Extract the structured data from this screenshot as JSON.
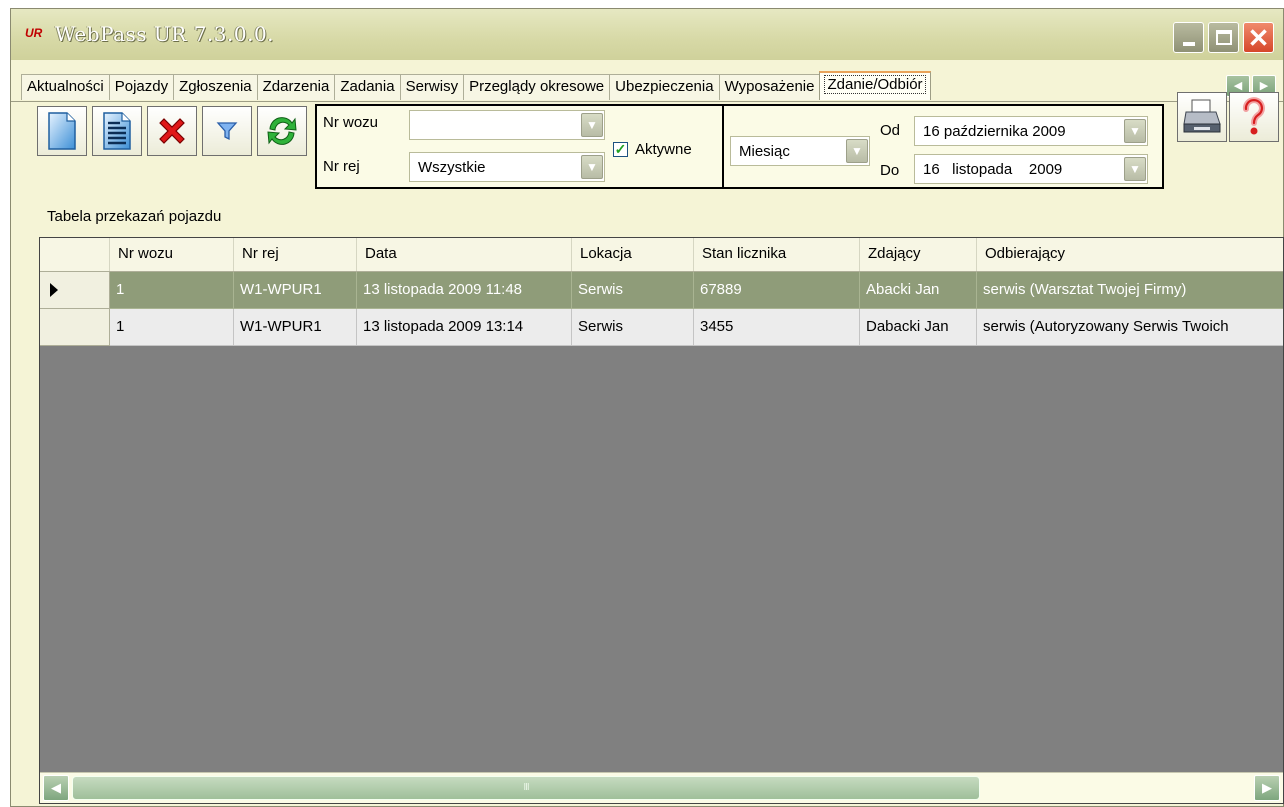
{
  "window": {
    "title": "WebPass UR 7.3.0.0."
  },
  "tabs": [
    {
      "label": "Aktualności"
    },
    {
      "label": "Pojazdy"
    },
    {
      "label": "Zgłoszenia"
    },
    {
      "label": "Zdarzenia"
    },
    {
      "label": "Zadania"
    },
    {
      "label": "Serwisy"
    },
    {
      "label": "Przeglądy okresowe"
    },
    {
      "label": "Ubezpieczenia"
    },
    {
      "label": "Wyposażenie"
    },
    {
      "label": "Zdanie/Odbiór",
      "active": true
    }
  ],
  "toolbar": {
    "buttons": [
      "new-document-icon",
      "document-list-icon",
      "delete-icon",
      "filter-icon",
      "refresh-icon"
    ],
    "print_icon": "printer-icon",
    "help_icon": "help-icon"
  },
  "filters": {
    "nr_wozu_label": "Nr wozu",
    "nr_wozu_value": "",
    "nr_rej_label": "Nr rej",
    "nr_rej_value": "Wszystkie",
    "active_label": "Aktywne",
    "active_checked": true,
    "period_value": "Miesiąc",
    "from_label": "Od",
    "from_value": "16 października 2009",
    "to_label": "Do",
    "to_value": "16   listopada    2009"
  },
  "table": {
    "caption": "Tabela przekazań pojazdu",
    "columns": [
      "Nr wozu",
      "Nr rej",
      "Data",
      "Lokacja",
      "Stan licznika",
      "Zdający",
      "Odbierający"
    ],
    "rows": [
      [
        "1",
        "W1-WPUR1",
        "13 listopada 2009 11:48",
        "Serwis",
        "67889",
        "Abacki Jan",
        "serwis (Warsztat Twojej Firmy)"
      ],
      [
        "1",
        "W1-WPUR1",
        "13 listopada 2009 13:14",
        "Serwis",
        "3455",
        "Dabacki Jan",
        "serwis (Autoryzowany Serwis Twoich"
      ]
    ],
    "selected_row": 0
  },
  "colors": {
    "selected_row": "#8f9c79",
    "window_bg": "#f5f4d6",
    "grid_bg": "#808080"
  }
}
